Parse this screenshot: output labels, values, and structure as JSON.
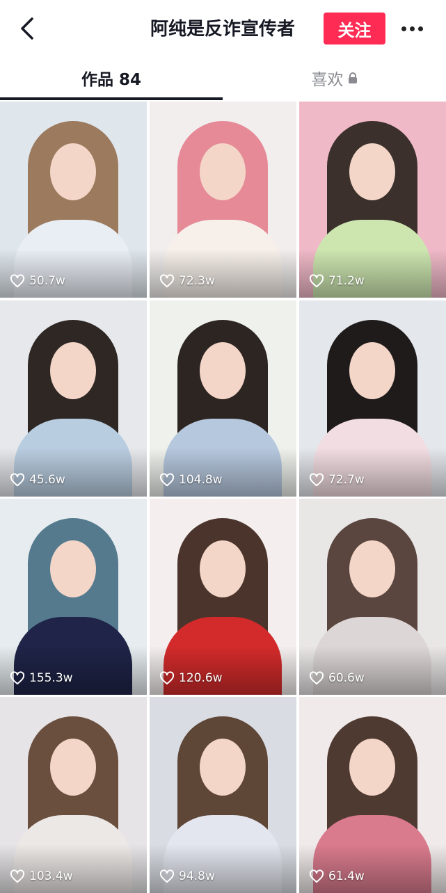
{
  "header": {
    "title": "阿纯是反诈宣传者",
    "follow_label": "关注"
  },
  "tabs": {
    "works_label": "作品 84",
    "likes_label": "喜欢"
  },
  "videos": [
    {
      "likes": "50.7w",
      "bg": "#dfe6ec",
      "hair": "#9b7a5e",
      "shirt": "#e9eef5"
    },
    {
      "likes": "72.3w",
      "bg": "#f2eeee",
      "hair": "#e58a96",
      "shirt": "#f7f0ea"
    },
    {
      "likes": "71.2w",
      "bg": "#f0b9c8",
      "hair": "#3b302b",
      "shirt": "#cde6b0"
    },
    {
      "likes": "45.6w",
      "bg": "#e6e8ec",
      "hair": "#2e2724",
      "shirt": "#b9cde0"
    },
    {
      "likes": "104.8w",
      "bg": "#eef1ec",
      "hair": "#2d2522",
      "shirt": "#b6c8de"
    },
    {
      "likes": "72.7w",
      "bg": "#e4e7ec",
      "hair": "#1f1b1b",
      "shirt": "#f2dde2"
    },
    {
      "likes": "155.3w",
      "bg": "#e6ecef",
      "hair": "#557a8e",
      "shirt": "#1f2448"
    },
    {
      "likes": "120.6w",
      "bg": "#f4eeee",
      "hair": "#4a342b",
      "shirt": "#d32b2b"
    },
    {
      "likes": "60.6w",
      "bg": "#e9e6e6",
      "hair": "#5a463e",
      "shirt": "#ddd6d6"
    },
    {
      "likes": "103.4w",
      "bg": "#e6e4e6",
      "hair": "#6a4f3f",
      "shirt": "#ece8e6"
    },
    {
      "likes": "94.8w",
      "bg": "#d9dde3",
      "hair": "#5f4738",
      "shirt": "#e3e6ee"
    },
    {
      "likes": "61.4w",
      "bg": "#f1eaea",
      "hair": "#4f3a31",
      "shirt": "#d97b8d"
    }
  ],
  "colors": {
    "accent": "#fe2c55",
    "text": "#161823",
    "muted": "#8a8b91"
  }
}
